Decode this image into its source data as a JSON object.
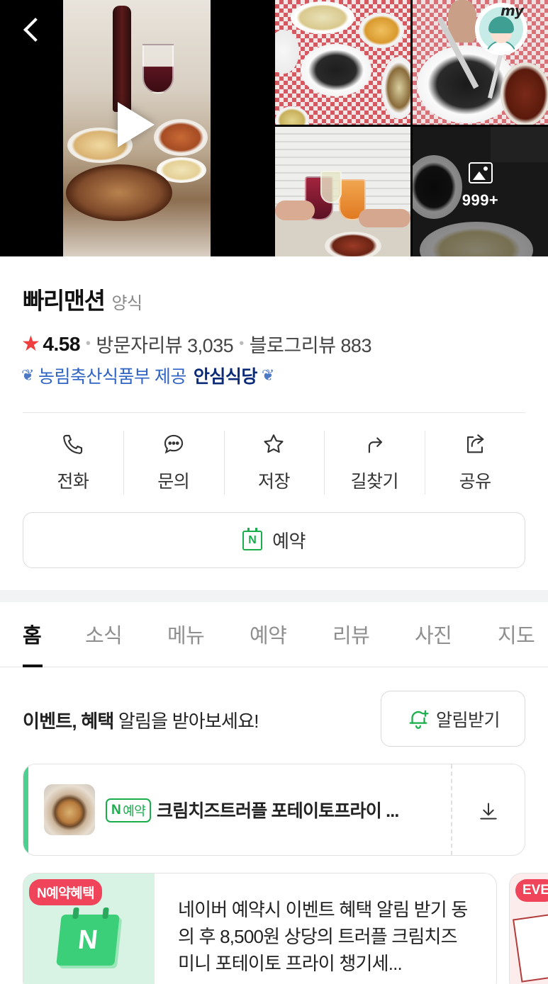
{
  "gallery": {
    "photo_count": "999+"
  },
  "header": {
    "avatar_label": "my"
  },
  "place": {
    "name": "빠리맨션",
    "category": "양식",
    "rating": "4.58",
    "visitor_reviews": "방문자리뷰 3,035",
    "blog_reviews": "블로그리뷰 883",
    "cert_provider": "농림축산식품부 제공",
    "cert_name": "안심식당"
  },
  "actions": {
    "call": "전화",
    "inquiry": "문의",
    "save": "저장",
    "directions": "길찾기",
    "share": "공유",
    "reserve": "예약"
  },
  "tabs": [
    "홈",
    "소식",
    "메뉴",
    "예약",
    "리뷰",
    "사진",
    "지도"
  ],
  "alert": {
    "text_bold": "이벤트, 혜택",
    "text_rest": " 알림을 받아보세요!",
    "button": "알림받기"
  },
  "coupon": {
    "badge_n": "N",
    "badge_label": "예약",
    "title": "크림치즈트러플 포테이토프라이 ..."
  },
  "event": {
    "tag": "N예약혜택",
    "calendar_letter": "N",
    "description": "네이버 예약시 이벤트 혜택 알림 받기 동의 후 8,500원 상당의 트러플 크림치즈 미니 포테이토 프라이 챙기세..."
  },
  "event2": {
    "tag": "EVE"
  },
  "colors": {
    "naver_green": "#19ae4b",
    "rating_star": "#f03e3e",
    "cert_blue": "#2f64c4",
    "event_tag": "#f0445b"
  }
}
